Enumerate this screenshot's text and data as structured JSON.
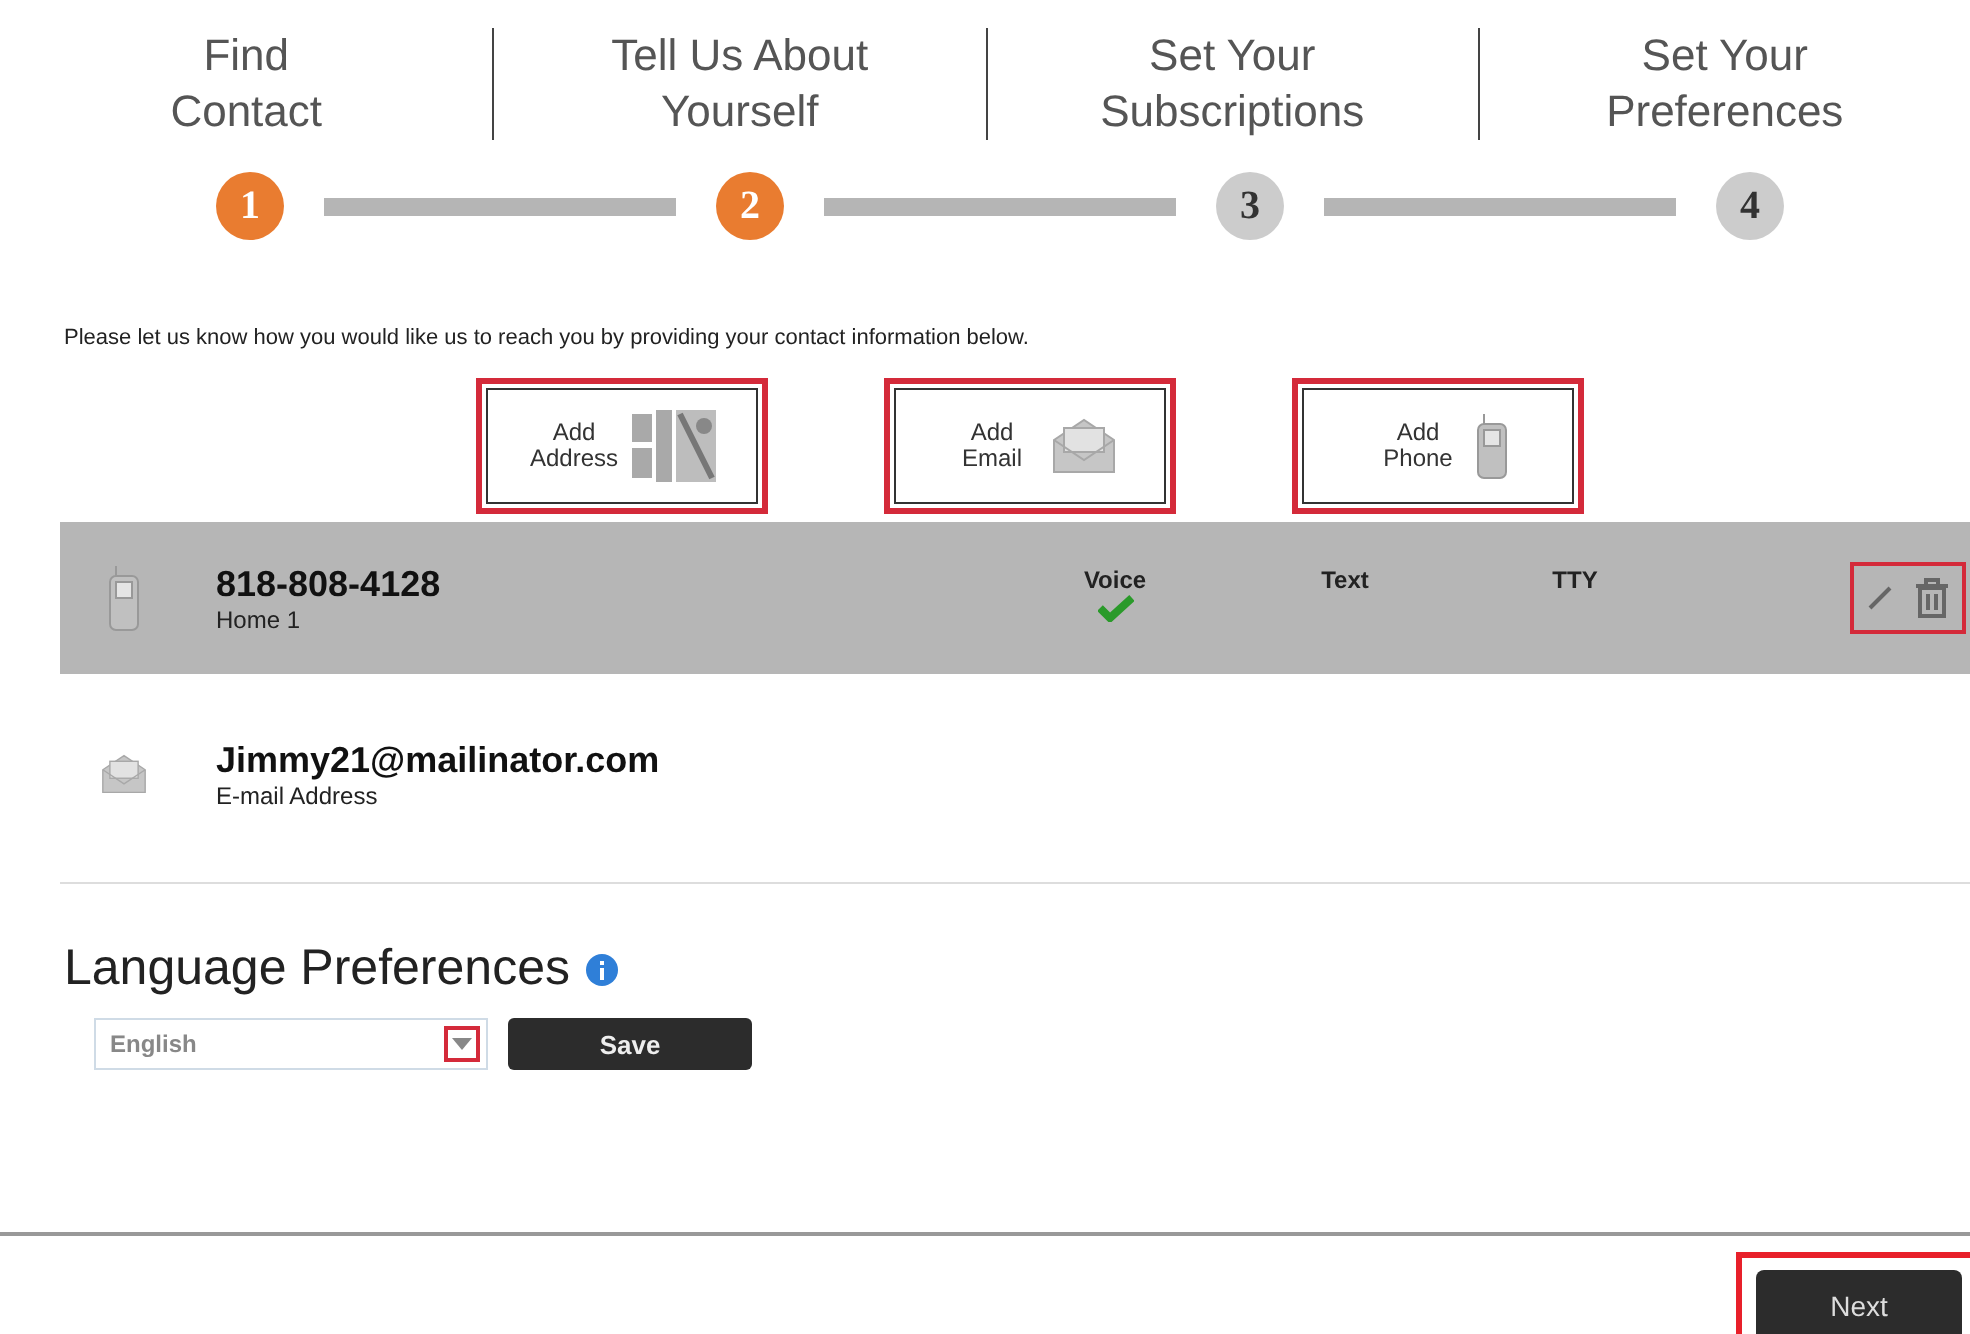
{
  "steps": [
    {
      "label": "Find\nContact",
      "number": "1",
      "completed": true
    },
    {
      "label": "Tell Us About\nYourself",
      "number": "2",
      "completed": true
    },
    {
      "label": "Set Your\nSubscriptions",
      "number": "3",
      "completed": false
    },
    {
      "label": "Set Your\nPreferences",
      "number": "4",
      "completed": false
    }
  ],
  "intro": "Please let us know how you would like us to reach you by providing your contact information below.",
  "add_buttons": [
    {
      "kind": "address",
      "label": "Add Address",
      "highlighted": true
    },
    {
      "kind": "email",
      "label": "Add Email",
      "highlighted": true
    },
    {
      "kind": "phone",
      "label": "Add Phone",
      "highlighted": true
    }
  ],
  "contacts": [
    {
      "kind": "phone",
      "value": "818-808-4128",
      "type": "Home 1",
      "selected": true,
      "actions_highlighted": true,
      "channels": [
        {
          "label": "Voice",
          "checked": true
        },
        {
          "label": "Text",
          "checked": false
        },
        {
          "label": "TTY",
          "checked": false
        }
      ]
    },
    {
      "kind": "email",
      "value": "Jimmy21@mailinator.com",
      "type": "E-mail Address",
      "selected": false
    }
  ],
  "language": {
    "heading": "Language Preferences",
    "value": "English",
    "dropdown_highlighted": true,
    "save": "Save"
  },
  "next": {
    "label": "Next",
    "highlighted": true
  }
}
